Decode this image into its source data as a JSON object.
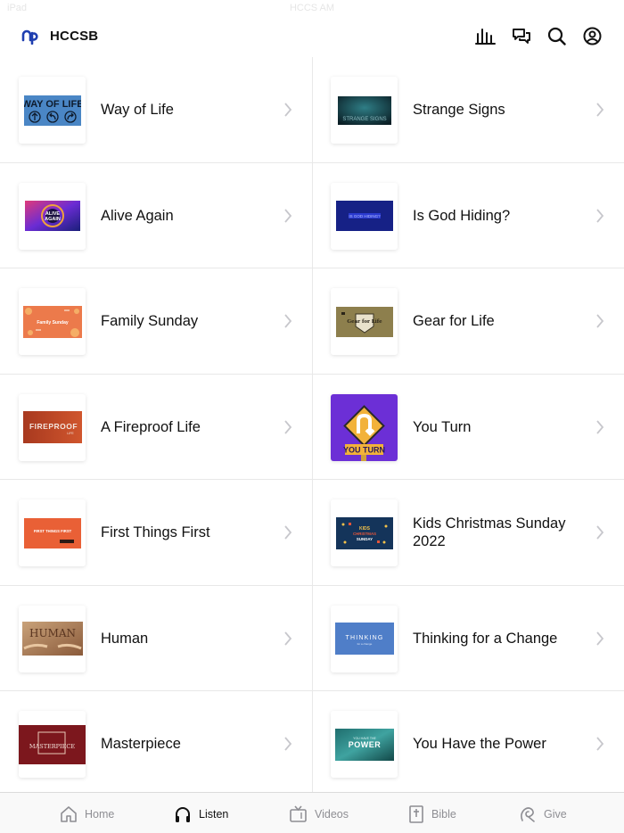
{
  "status_bar": {
    "left": "iPad",
    "center": "HCCS AM"
  },
  "header": {
    "app_name": "HCCSB"
  },
  "items": [
    {
      "left": {
        "title": "Way of Life",
        "thumb_text": "WAY OF LIFE"
      },
      "right": {
        "title": "Strange Signs",
        "thumb_text": "STRANGE SIGNS"
      }
    },
    {
      "left": {
        "title": "Alive Again",
        "thumb_text": "ALIVE AGAIN"
      },
      "right": {
        "title": "Is God Hiding?",
        "thumb_text": "IS GOD HIDING?"
      }
    },
    {
      "left": {
        "title": "Family Sunday",
        "thumb_text": "Family Sunday"
      },
      "right": {
        "title": "Gear for Life",
        "thumb_text": "Gear for Life"
      }
    },
    {
      "left": {
        "title": "A Fireproof Life",
        "thumb_text": "FIREPROOF"
      },
      "right": {
        "title": "You Turn",
        "thumb_text": "YOU TURN"
      }
    },
    {
      "left": {
        "title": "First Things First",
        "thumb_text": "FIRST THINGS FIRST"
      },
      "right": {
        "title": "Kids Christmas Sunday 2022",
        "thumb_text": "KIDS CHRISTMAS SUNDAY"
      }
    },
    {
      "left": {
        "title": "Human",
        "thumb_text": "HUMAN"
      },
      "right": {
        "title": "Thinking for a Change",
        "thumb_text": "THINKING"
      }
    },
    {
      "left": {
        "title": "Masterpiece",
        "thumb_text": "MASTERPIECE"
      },
      "right": {
        "title": "You Have the Power",
        "thumb_text": "POWER"
      }
    }
  ],
  "tabs": [
    {
      "label": "Home",
      "icon": "home-icon"
    },
    {
      "label": "Listen",
      "icon": "headphones-icon"
    },
    {
      "label": "Videos",
      "icon": "tv-icon"
    },
    {
      "label": "Bible",
      "icon": "bible-icon"
    },
    {
      "label": "Give",
      "icon": "give-icon"
    }
  ],
  "colors": {
    "brand_blue": "#1f3fb0",
    "active_tab": "#111111",
    "inactive_tab": "#8e8e93",
    "divider": "#e8e8e8"
  }
}
